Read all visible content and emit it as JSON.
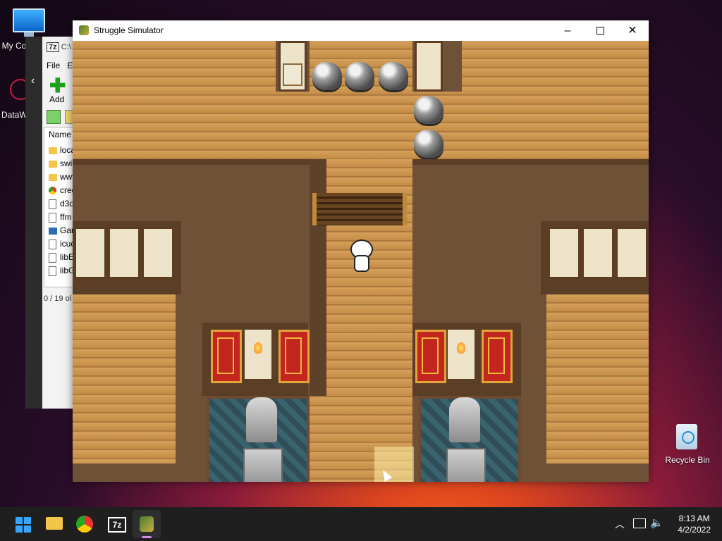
{
  "desktop": {
    "icons": [
      {
        "label": "My Co",
        "icon": "computer-icon"
      },
      {
        "label": "DataW",
        "icon": "app-shortcut-icon"
      },
      {
        "label": "Recycle Bin",
        "icon": "recycle-bin-icon"
      }
    ]
  },
  "background_window": {
    "title": "C:\\",
    "menu": [
      "File",
      "E"
    ],
    "toolbar": {
      "add_label": "Add"
    },
    "column_header": "Name",
    "files": [
      "loca",
      "swif",
      "www",
      "cred",
      "d3d",
      "ffm",
      "Gan",
      "icuc",
      "libE",
      "libG"
    ],
    "status": "0 / 19 ol"
  },
  "game_window": {
    "title": "Struggle Simulator",
    "controls": [
      "minimize",
      "maximize",
      "close"
    ]
  },
  "taskbar": {
    "apps": [
      "start-icon",
      "file-explorer-icon",
      "chrome-icon",
      "7zip-icon",
      "game-icon"
    ],
    "tray": [
      "chevron-up-icon",
      "network-icon",
      "volume-icon"
    ],
    "time": "8:13 AM",
    "date": "4/2/2022"
  },
  "colors": {
    "accent": "#34a6ff",
    "taskbar": "#1f1f1f"
  }
}
